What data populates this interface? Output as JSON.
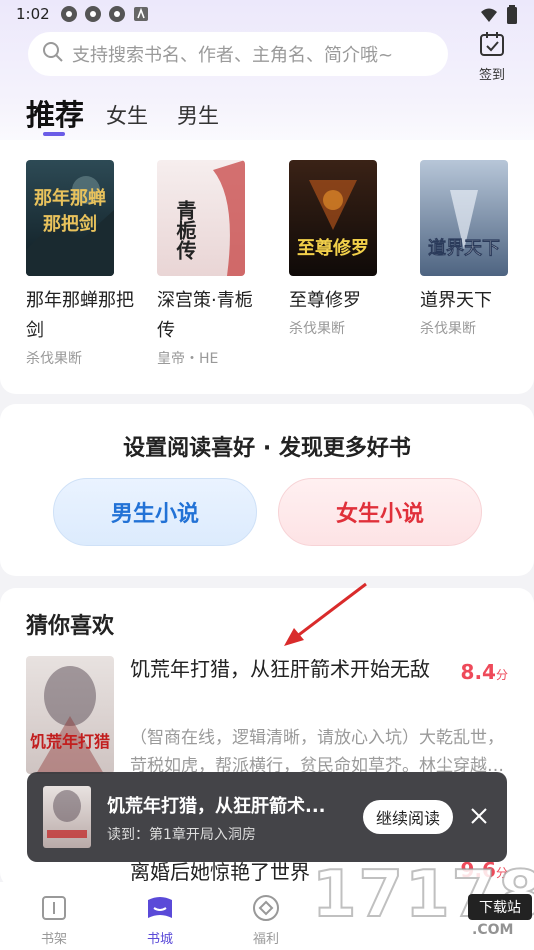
{
  "status_bar": {
    "time": "1:02"
  },
  "search": {
    "placeholder": "支持搜索书名、作者、主角名、简介哦~"
  },
  "checkin": {
    "label": "签到"
  },
  "tabs": [
    {
      "label": "推荐",
      "active": true
    },
    {
      "label": "女生",
      "active": false
    },
    {
      "label": "男生",
      "active": false
    }
  ],
  "recommend": [
    {
      "title": "那年那蝉那把剑",
      "author": "杀伐果断",
      "cover_text": "那年那蝉那把剑",
      "cover_colors": [
        "#2d4a55",
        "#0f1c22"
      ]
    },
    {
      "title": "深宫策·青栀传",
      "author": "皇帝・HE",
      "cover_text": "青栀传",
      "cover_colors": [
        "#f6eeee",
        "#e9d5d5"
      ]
    },
    {
      "title": "至尊修罗",
      "author": "杀伐果断",
      "cover_text": "至尊修罗",
      "cover_colors": [
        "#3a2216",
        "#0f0a08"
      ]
    },
    {
      "title": "道界天下",
      "author": "杀伐果断",
      "cover_text": "道界天下",
      "cover_colors": [
        "#b7c6d8",
        "#4e6481"
      ]
    }
  ],
  "preference": {
    "title": "设置阅读喜好 · 发现更多好书",
    "male_label": "男生小说",
    "female_label": "女生小说"
  },
  "guess": {
    "title": "猜你喜欢",
    "items": [
      {
        "title": "饥荒年打猎，从狂肝箭术开始无敌",
        "score": "8.4",
        "unit": "分",
        "desc": "（智商在线，逻辑清晰，请放心入坑）大乾乱世，苛税如虎，帮派横行，贫民命如草芥。林尘穿越…",
        "cover_text": "饥荒年打猎"
      },
      {
        "title": "离婚后她惊艳了世界",
        "score": "9.6",
        "unit": "分"
      }
    ]
  },
  "continue_reading": {
    "title": "饥荒年打猎，从狂肝箭术...",
    "progress": "读到：第1章开局入洞房",
    "button": "继续阅读"
  },
  "bottom_nav": [
    {
      "label": "书架",
      "icon": "bookshelf-icon",
      "active": false
    },
    {
      "label": "书城",
      "icon": "bookstore-icon",
      "active": true
    },
    {
      "label": "福利",
      "icon": "welfare-icon",
      "active": false
    }
  ],
  "watermark": {
    "text": "17178",
    "badge": "下载站",
    "domain": ".COM"
  },
  "colors": {
    "accent": "#6b5ce7",
    "score": "#ee4a5a",
    "male": "#2272d6",
    "female": "#e0303a",
    "arrow": "#d92b2b"
  }
}
